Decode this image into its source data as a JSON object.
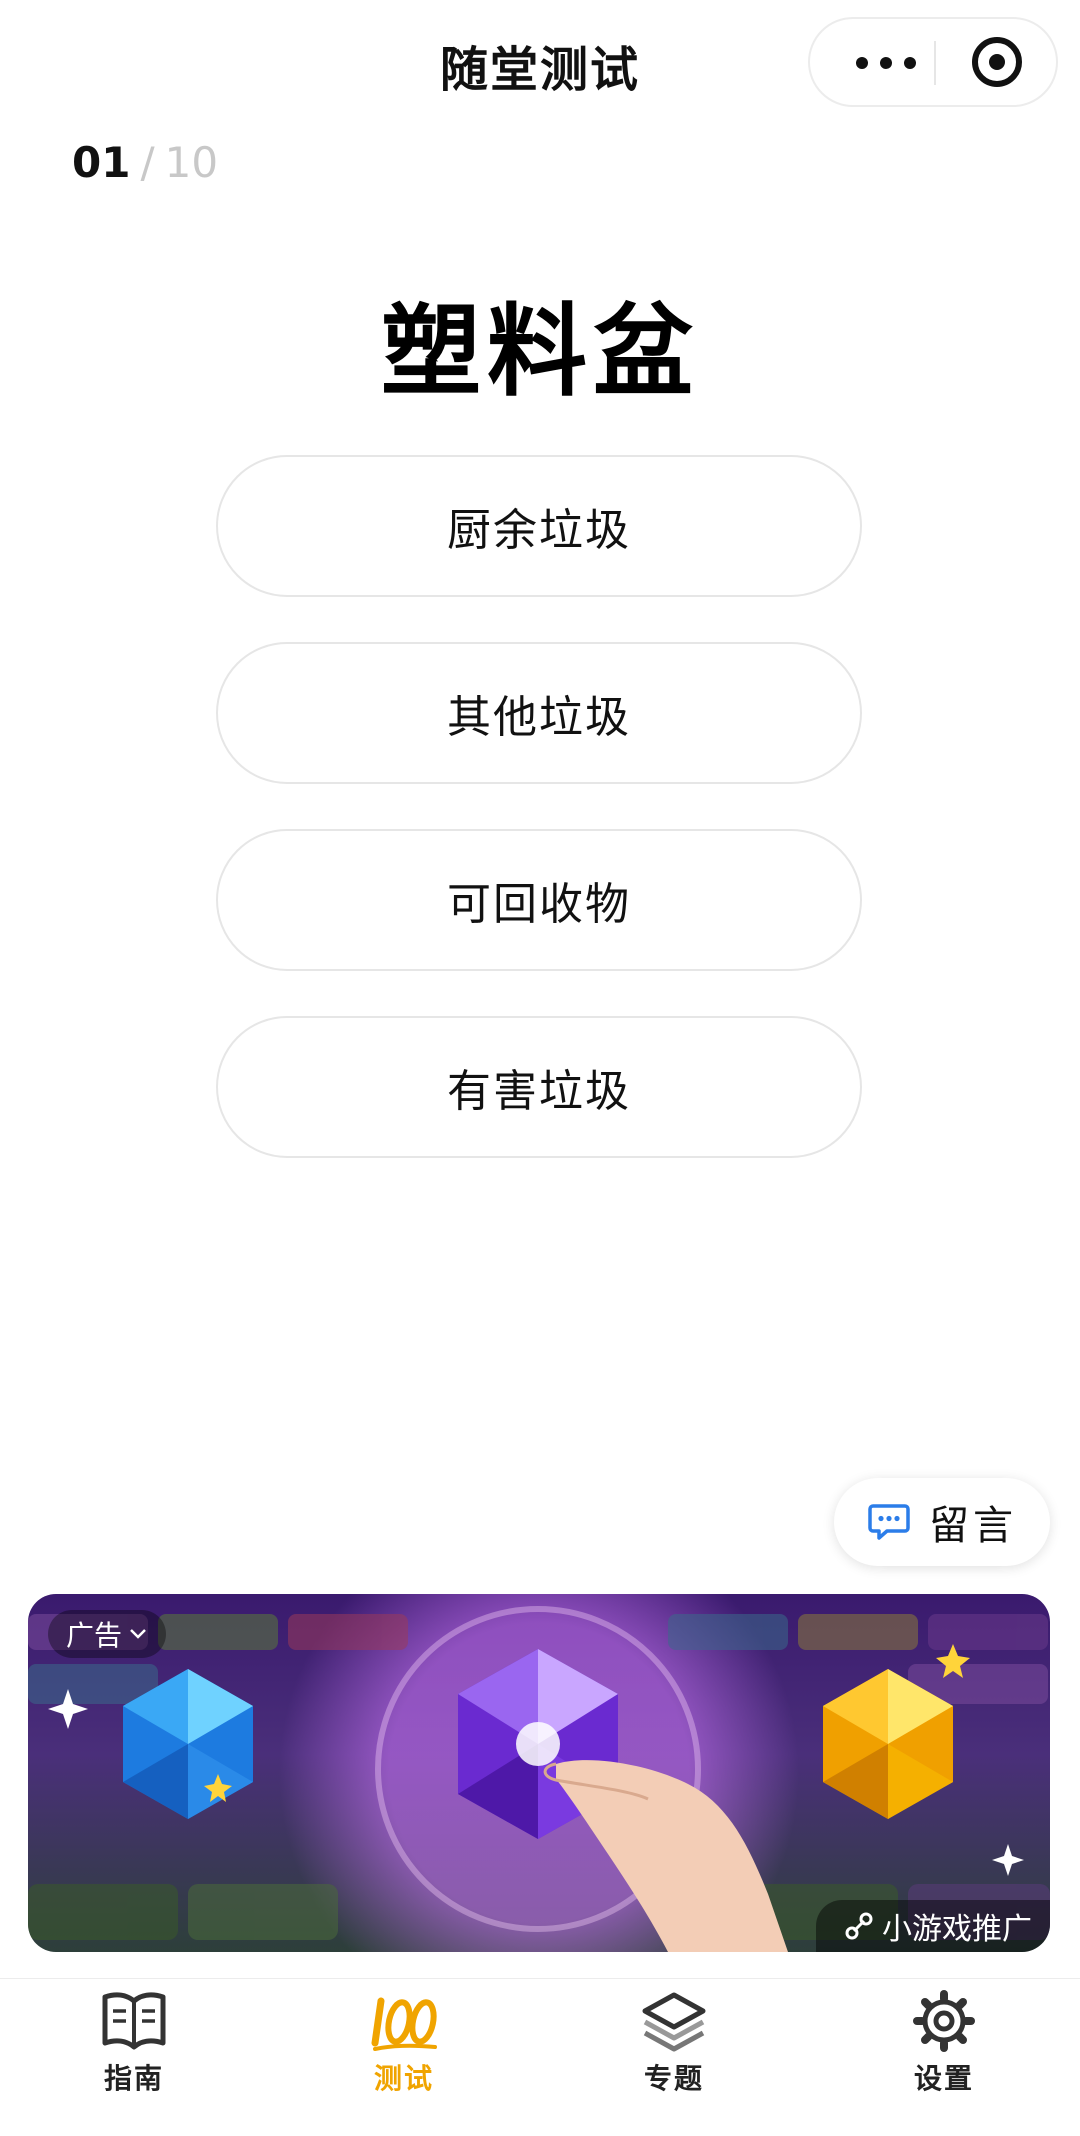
{
  "nav": {
    "title": "随堂测试"
  },
  "progress": {
    "current": "01",
    "separator": "/",
    "total": "10"
  },
  "question": {
    "item": "塑料盆"
  },
  "options": [
    "厨余垃圾",
    "其他垃圾",
    "可回收物",
    "有害垃圾"
  ],
  "message_button": {
    "label": "留言"
  },
  "ad": {
    "badge": "广告",
    "promo": "小游戏推广"
  },
  "tabs": [
    {
      "label": "指南",
      "icon": "book-icon",
      "active": false
    },
    {
      "label": "测试",
      "icon": "hundred-icon",
      "active": true
    },
    {
      "label": "专题",
      "icon": "layers-icon",
      "active": false
    },
    {
      "label": "设置",
      "icon": "gear-icon",
      "active": false
    }
  ],
  "colors": {
    "accent": "#f0a400",
    "message_icon": "#2b7de9",
    "text": "#111111",
    "muted": "#c8c8c8"
  }
}
